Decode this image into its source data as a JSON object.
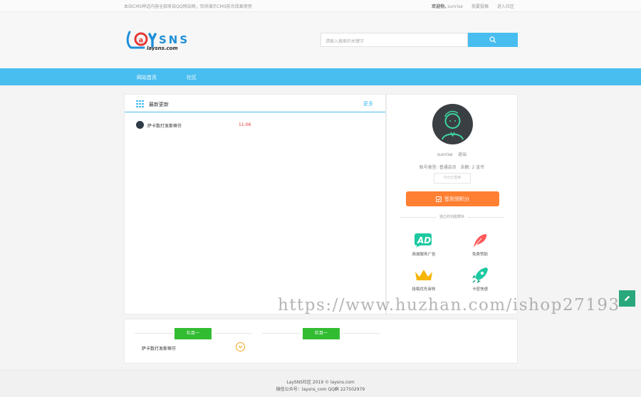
{
  "topbar": {
    "notice": "本站CMS神话内容全部来自QQ网站网，仅供演示CMS前台效果使用",
    "welcome_prefix": "欢迎你,",
    "username": "sunrise",
    "publish_link": "我要投稿",
    "enter_community": "进入社区"
  },
  "header": {
    "logo_text": "LaySNS",
    "logo_sub": "laysns.com",
    "search_placeholder": "请输入搜索的关键字"
  },
  "nav": {
    "items": [
      {
        "label": "网站首页"
      },
      {
        "label": "社区"
      }
    ]
  },
  "latest": {
    "title": "最新更新",
    "more": "更多",
    "items": [
      {
        "title": "萨卡数打发斯蒂芬",
        "date": "11-06"
      }
    ]
  },
  "user": {
    "name": "sunrise",
    "logout": "退出",
    "account_type_label": "账号类型:",
    "account_type": "普通会员",
    "balance_label": "余额:",
    "balance": "2 金币",
    "not_signed": "今日已签到",
    "signin_button": "签到领积分",
    "section_title": "独立的功能模块",
    "features": [
      {
        "label": "商城服务广告",
        "icon": "ad-icon"
      },
      {
        "label": "免费赞助",
        "icon": "feather-icon"
      },
      {
        "label": "投稿优先审核",
        "icon": "crown-icon"
      },
      {
        "label": "卡密快速",
        "icon": "rocket-icon"
      }
    ]
  },
  "columns": [
    {
      "tag": "栏目一",
      "items": [
        {
          "title": "萨卡数打发斯蒂芬"
        }
      ]
    },
    {
      "tag": "栏目一",
      "items": []
    }
  ],
  "footer": {
    "line1": "LaySNS社区 2019 © laysns.com",
    "line2": "微信公众号：laysns_com QQ群 227502979"
  },
  "watermark": "https://www.huzhan.com/ishop27193",
  "colors": {
    "accent": "#48bdf0",
    "orange": "#ff7f33",
    "green": "#32bc32",
    "date_red": "#e53935"
  }
}
